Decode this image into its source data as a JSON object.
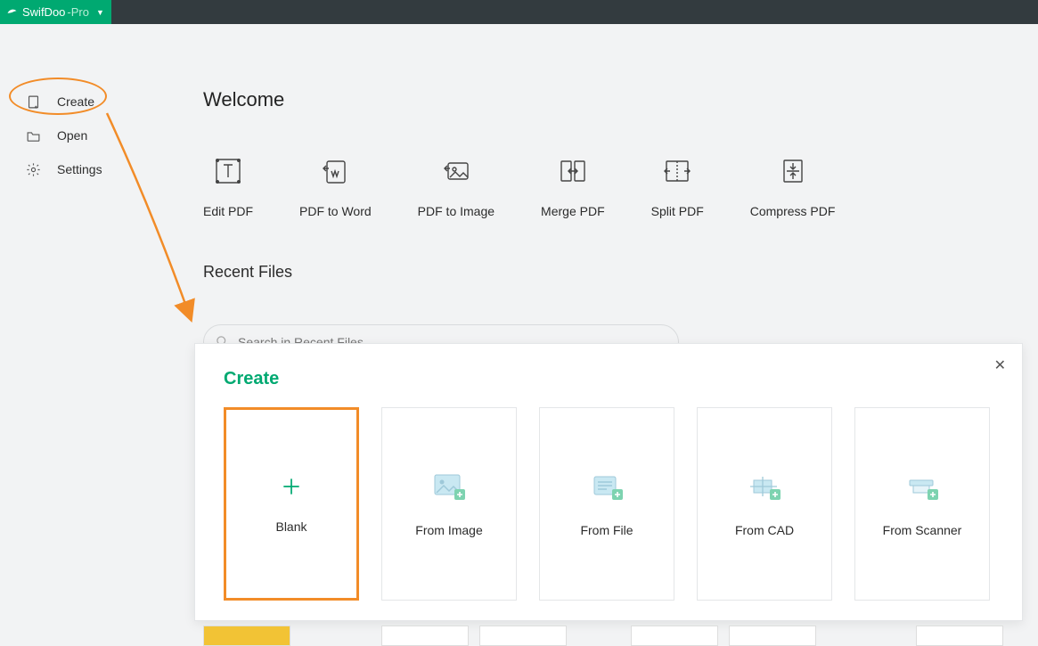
{
  "brand": {
    "name": "SwifDoo",
    "suffix": "-Pro"
  },
  "sidebar": {
    "items": [
      {
        "label": "Create"
      },
      {
        "label": "Open"
      },
      {
        "label": "Settings"
      }
    ]
  },
  "main": {
    "welcome_title": "Welcome",
    "recent_title": "Recent Files",
    "search_placeholder": "Search in Recent Files",
    "quick_actions": [
      {
        "label": "Edit PDF"
      },
      {
        "label": "PDF to Word"
      },
      {
        "label": "PDF to Image"
      },
      {
        "label": "Merge PDF"
      },
      {
        "label": "Split PDF"
      },
      {
        "label": "Compress PDF"
      }
    ]
  },
  "popup": {
    "title": "Create",
    "options": [
      {
        "label": "Blank",
        "selected": true
      },
      {
        "label": "From Image"
      },
      {
        "label": "From File"
      },
      {
        "label": "From CAD"
      },
      {
        "label": "From Scanner"
      }
    ]
  },
  "colors": {
    "accent": "#00a971",
    "highlight": "#f28c28"
  }
}
